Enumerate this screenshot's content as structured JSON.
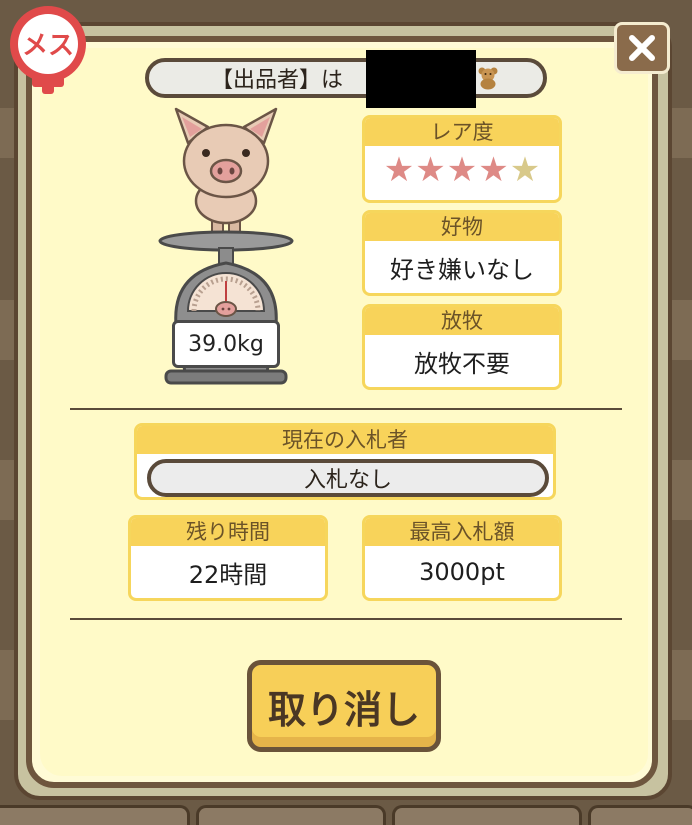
{
  "gender_badge": {
    "text": "メス",
    "color": "#e04a4a"
  },
  "close_button": {
    "icon": "close-icon"
  },
  "seller": {
    "prefix": "【出品者】は",
    "name": ""
  },
  "weight": "39.0kg",
  "rarity": {
    "label": "レア度",
    "rating": 4,
    "max": 5,
    "filled_color": "#de8a86",
    "empty_color": "#d8c98a"
  },
  "favorite": {
    "label": "好物",
    "value": "好き嫌いなし"
  },
  "grazing": {
    "label": "放牧",
    "value": "放牧不要"
  },
  "current_bidder": {
    "label": "現在の入札者",
    "value": "入札なし"
  },
  "remaining_time": {
    "label": "残り時間",
    "value": "22時間"
  },
  "highest_bid": {
    "label": "最高入札額",
    "value": "3000pt"
  },
  "cancel_button": {
    "label": "取り消し"
  }
}
